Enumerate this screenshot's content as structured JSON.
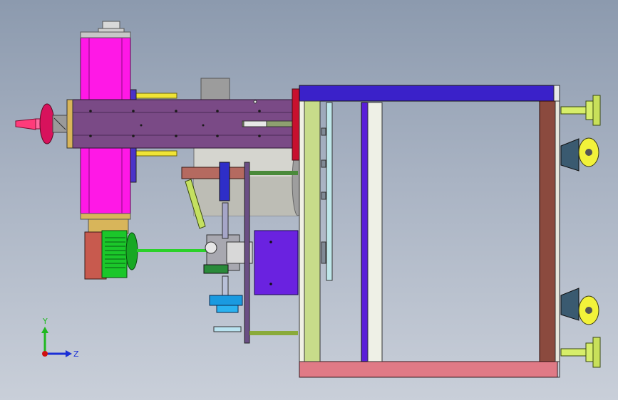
{
  "triad": {
    "y_label": "Y",
    "z_label": "Z",
    "y_color": "#1fb81f",
    "z_color": "#1a2fd6",
    "origin_color": "#d01010"
  },
  "colors": {
    "background_top": "#8c9aae",
    "background_bottom": "#c9cfd9",
    "spindle_housing": "#ff18e6",
    "main_shaft": "#7a4a86",
    "frame_top_rail": "#3a21c9",
    "frame_bottom_rail": "#e07a86",
    "frame_post_left": "#c7dc8a",
    "frame_post_right": "#8b4a3e",
    "motor": "#1bc72a",
    "motor_base": "#c85a4e",
    "control_box": "#6a22e0",
    "caster_wheel": "#f2f23a",
    "leveling_foot": "#d7ee6a",
    "mount_plate": "#f0e436",
    "drive_rod": "#2ad12a"
  }
}
